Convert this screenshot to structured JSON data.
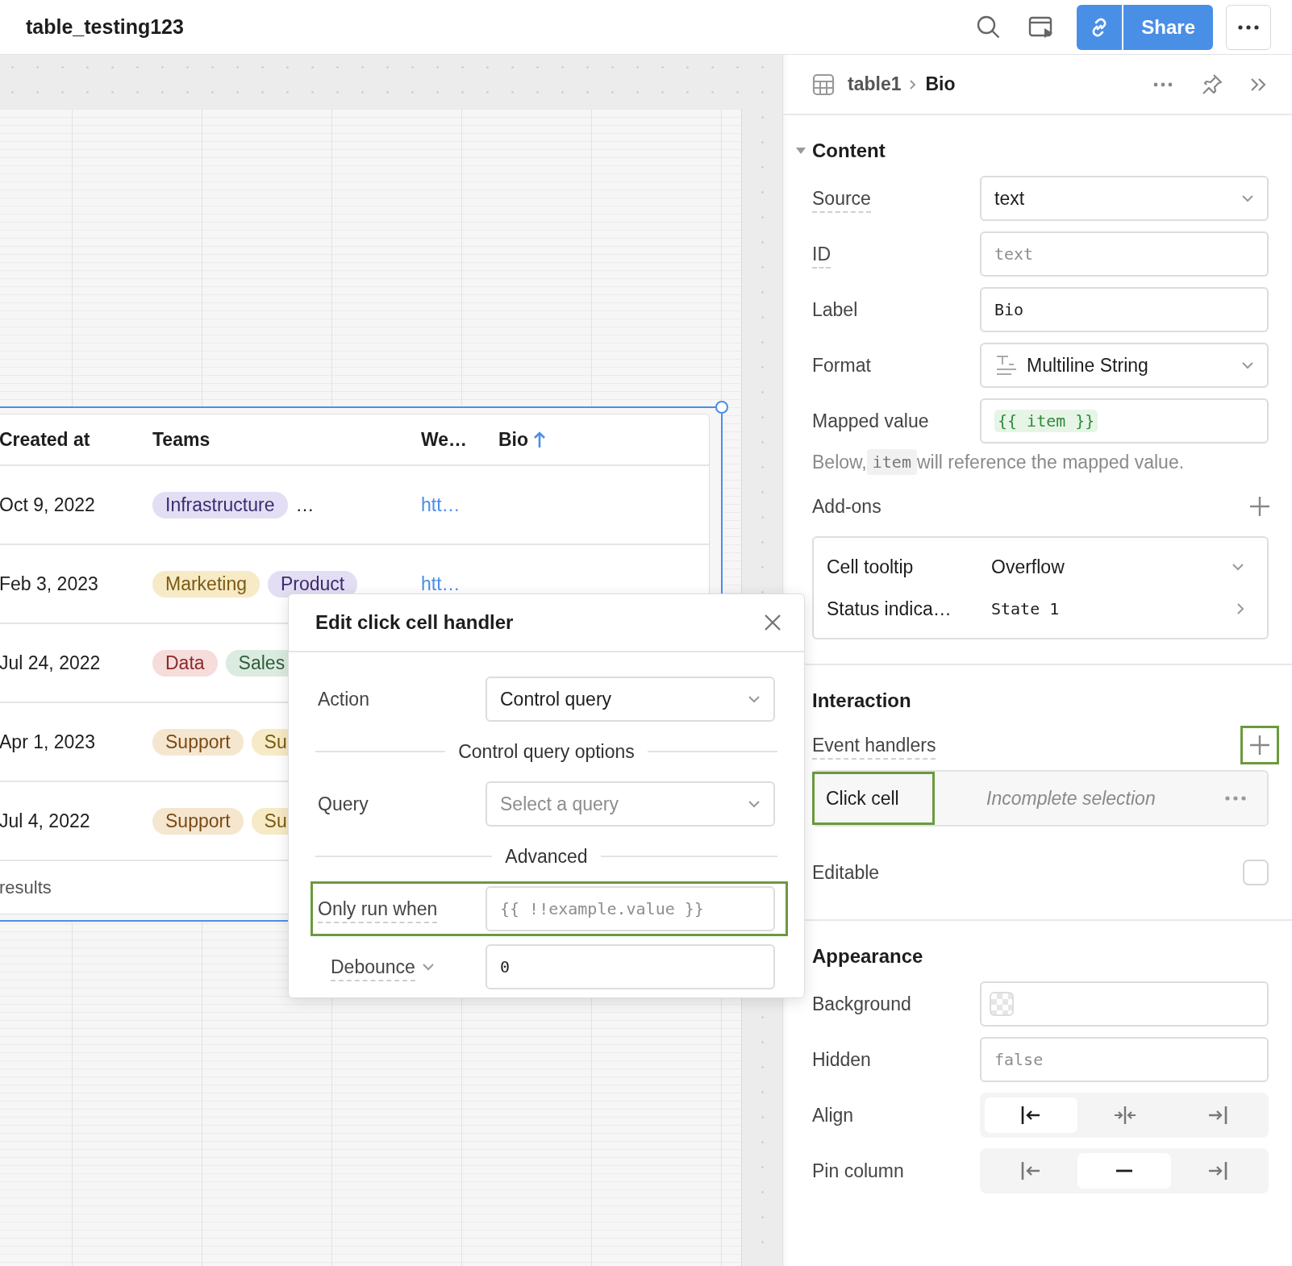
{
  "app": {
    "title": "table_testing123",
    "share_label": "Share"
  },
  "table": {
    "columns": [
      {
        "label": "Created at",
        "sorted": false
      },
      {
        "label": "Teams",
        "sorted": false
      },
      {
        "label": "We…",
        "sorted": false
      },
      {
        "label": "Bio",
        "sorted": true
      }
    ],
    "rows": [
      {
        "created_at": "Oct 9, 2022",
        "teams": [
          {
            "label": "Infrastructure",
            "color": "#e4def4"
          }
        ],
        "overflow": "…",
        "website": "htt…"
      },
      {
        "created_at": "Feb 3, 2023",
        "teams": [
          {
            "label": "Marketing",
            "color": "#f7eac6"
          },
          {
            "label": "Product",
            "color": "#e4def4"
          }
        ],
        "website": "htt…"
      },
      {
        "created_at": "Jul 24, 2022",
        "teams": [
          {
            "label": "Data",
            "color": "#f7dcdc"
          },
          {
            "label": "Sales",
            "color": "#dcebdf"
          }
        ]
      },
      {
        "created_at": "Apr 1, 2023",
        "teams": [
          {
            "label": "Support",
            "color": "#f5e6cf"
          },
          {
            "label": "Su",
            "color": "#f7eac6"
          }
        ]
      },
      {
        "created_at": "Jul 4, 2022",
        "teams": [
          {
            "label": "Support",
            "color": "#f5e6cf"
          },
          {
            "label": "Su",
            "color": "#f7eac6"
          }
        ]
      }
    ],
    "footer": "results"
  },
  "handler_dialog": {
    "title": "Edit click cell handler",
    "fields": [
      {
        "kind": "select",
        "label": "Action",
        "value": "Control query",
        "tooltip": false,
        "highlighted": false
      },
      {
        "kind": "divider",
        "label": "Control query options"
      },
      {
        "kind": "select",
        "label": "Query",
        "placeholder": "Select a query",
        "tooltip": false,
        "highlighted": false
      },
      {
        "kind": "divider",
        "label": "Advanced"
      },
      {
        "kind": "code",
        "label": "Only run when",
        "placeholder": "{{ !!example.value }}",
        "tooltip": true,
        "highlighted": true
      },
      {
        "kind": "menu_code",
        "label": "Debounce",
        "value": "0",
        "tooltip": true,
        "highlighted": false
      }
    ]
  },
  "inspector": {
    "breadcrumb": [
      {
        "label": "table1",
        "current": false
      },
      {
        "label": "Bio",
        "current": true
      }
    ],
    "sections": [
      {
        "title": "Content",
        "expanded": true,
        "rows": [
          {
            "kind": "select",
            "label": "Source",
            "value": "text",
            "tooltip": true
          },
          {
            "kind": "code",
            "label": "ID",
            "placeholder": "text",
            "tooltip": true
          },
          {
            "kind": "code",
            "label": "Label",
            "value": "Bio",
            "tooltip": false
          },
          {
            "kind": "format_select",
            "label": "Format",
            "value": "Multiline String",
            "tooltip": false
          },
          {
            "kind": "template",
            "label": "Mapped value",
            "value": "{{ item }}",
            "tooltip": false
          },
          {
            "kind": "hint",
            "before": "Below, ",
            "code": "item",
            "after": " will reference the mapped value."
          },
          {
            "kind": "group_header",
            "label": "Add-ons",
            "highlighted": false
          },
          {
            "kind": "addons",
            "items": [
              {
                "label": "Cell tooltip",
                "value": "Overflow",
                "kind": "select"
              },
              {
                "label": "Status indica…",
                "value": "State 1",
                "kind": "link"
              }
            ]
          }
        ]
      },
      {
        "title": "Interaction",
        "rows": [
          {
            "kind": "group_header",
            "label": "Event handlers",
            "tooltip": true,
            "highlighted": true
          },
          {
            "kind": "handlers",
            "items": [
              {
                "event": "Click cell",
                "action": "Incomplete selection",
                "highlighted": true
              }
            ]
          },
          {
            "kind": "checkbox",
            "label": "Editable",
            "checked": false
          }
        ]
      },
      {
        "title": "Appearance",
        "rows": [
          {
            "kind": "color",
            "label": "Background"
          },
          {
            "kind": "code",
            "label": "Hidden",
            "placeholder": "false",
            "tooltip": false
          },
          {
            "kind": "segmented",
            "label": "Align",
            "options": [
              {
                "kind": "left",
                "selected": true
              },
              {
                "kind": "center",
                "selected": false
              },
              {
                "kind": "right",
                "selected": false
              }
            ]
          },
          {
            "kind": "segmented",
            "label": "Pin column",
            "options": [
              {
                "kind": "pin_left",
                "selected": false
              },
              {
                "kind": "none",
                "selected": true
              },
              {
                "kind": "pin_right",
                "selected": false
              }
            ]
          }
        ]
      }
    ]
  }
}
